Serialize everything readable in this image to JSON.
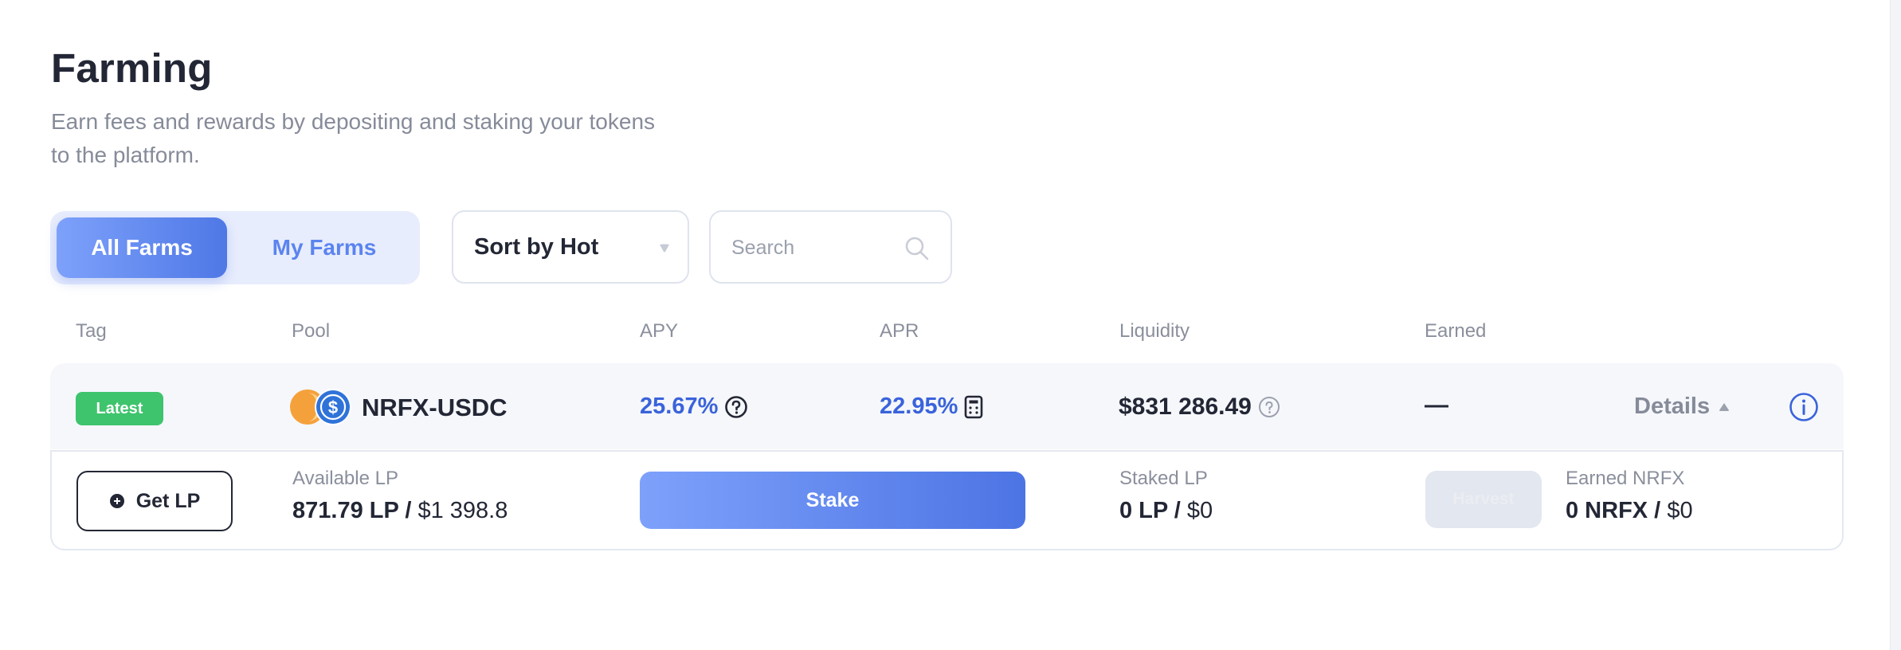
{
  "header": {
    "title": "Farming",
    "subtitle": "Earn fees and rewards by depositing and staking your tokens to the platform."
  },
  "filters": {
    "tabs": [
      {
        "label": "All Farms",
        "active": true
      },
      {
        "label": "My Farms",
        "active": false
      }
    ],
    "sort_label": "Sort by Hot",
    "search_placeholder": "Search"
  },
  "table": {
    "columns": [
      "Tag",
      "Pool",
      "APY",
      "APR",
      "Liquidity",
      "Earned"
    ]
  },
  "farm": {
    "tag": "Latest",
    "pair": "NRFX-USDC",
    "apy": "25.67%",
    "apr": "22.95%",
    "liquidity": "$831 286.49",
    "earned": "—",
    "details_label": "Details",
    "panel": {
      "get_lp_label": "Get LP",
      "available_label": "Available LP",
      "available_amount": "871.79 LP /",
      "available_usd": "$1 398.8",
      "stake_label": "Stake",
      "staked_label": "Staked LP",
      "staked_amount": "0 LP /",
      "staked_usd": "$0",
      "harvest_label": "Harvest",
      "earned_label": "Earned NRFX",
      "earned_amount": "0 NRFX /",
      "earned_usd": "$0"
    }
  },
  "colors": {
    "accent": "#4f78e6",
    "accent_light": "#7da1fb",
    "link_blue": "#3a63db",
    "tag_green": "#3ec46d",
    "text_dark": "#232735",
    "text_muted": "#868b99"
  },
  "icons": {
    "sort_caret": "caret-down-icon",
    "search": "search-icon",
    "apy_help": "question-circle-icon",
    "apr_calc": "calculator-icon",
    "liquidity_help": "question-circle-icon",
    "details": "chevron-icon",
    "info": "info-circle-icon",
    "get_lp": "plus-circle-icon"
  }
}
